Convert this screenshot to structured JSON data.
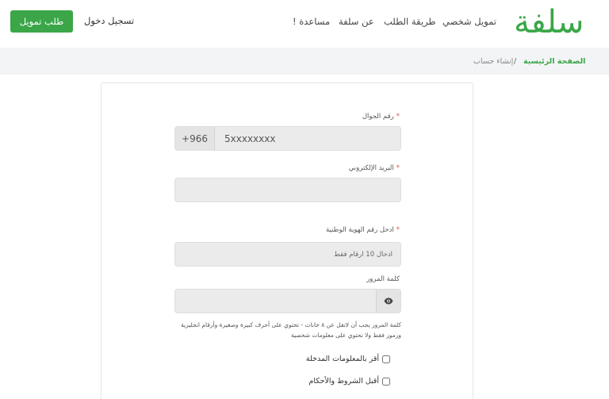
{
  "header": {
    "logo": "سلفة",
    "nav": [
      "تمويل شخصي",
      "طريقة الطلب",
      "عن سلفة",
      "مساعدة !"
    ],
    "login_label": "تسجيل دخول",
    "apply_label": "طلب تمويل",
    "accent_color": "#3aa648"
  },
  "breadcrumb": {
    "home": "الصفحة الرئيسية",
    "separator": "/",
    "current": "إنشاء حساب"
  },
  "form": {
    "mobile": {
      "label": "رقم الجوال",
      "required_mark": "*",
      "prefix": "+966",
      "placeholder": "5xxxxxxxx"
    },
    "email": {
      "label": "البريد الإلكتروني",
      "required_mark": "*",
      "placeholder": ""
    },
    "national_id": {
      "label": "ادخل رقم الهوية الوطنية",
      "required_mark": "*",
      "placeholder": "ادخال 10 ارقام فقط"
    },
    "password": {
      "label": "كلمة المرور",
      "placeholder": "",
      "icon": "eye-icon",
      "hint": "كلمة المرور يجب أن لاتقل عن ٨ خانات - تحتوي على أحرف كبيرة وصغيرة وأرقام انجليزية ورموز فقط ولا تحتوي على معلومات شخصية"
    },
    "confirm_label": "أقر بالمعلومات المدخلة",
    "terms_label": "أقبل الشروط والأحكام"
  }
}
